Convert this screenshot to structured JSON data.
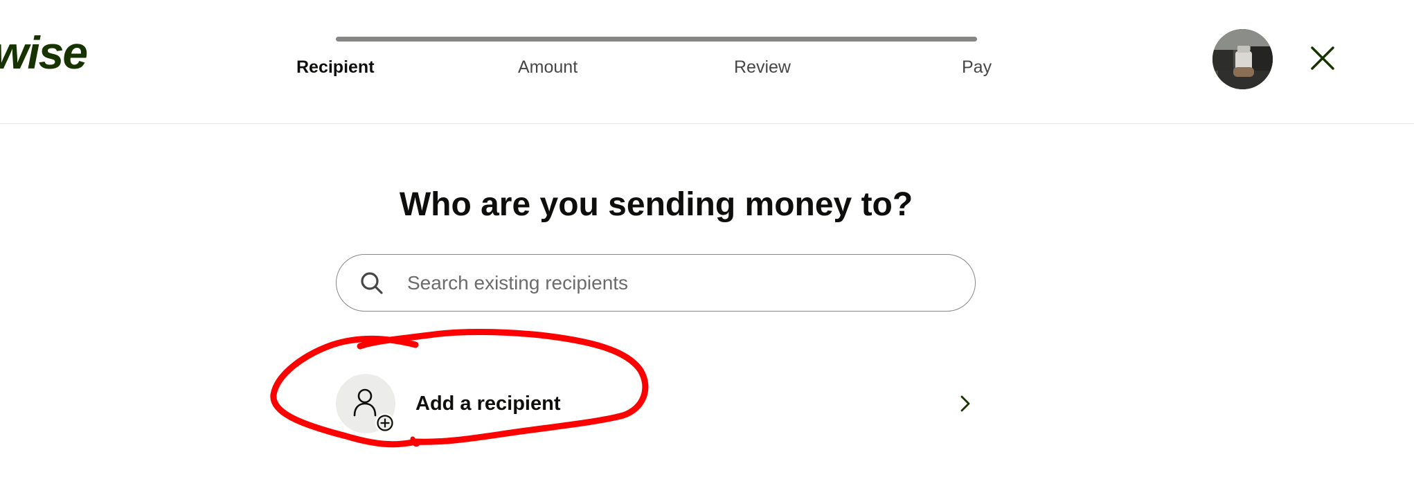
{
  "brand": {
    "logo_text": "wise",
    "logo_color": "#163300"
  },
  "progress": {
    "steps": [
      "Recipient",
      "Amount",
      "Review",
      "Pay"
    ],
    "active_step": "Recipient",
    "track_color": "#868685"
  },
  "header": {
    "avatar_icon": "user-photo",
    "close_icon": "close-icon"
  },
  "main": {
    "title": "Who are you sending money to?",
    "search": {
      "placeholder": "Search existing recipients",
      "value": "",
      "icon": "search-icon"
    },
    "add_recipient": {
      "label": "Add a recipient",
      "icon": "person-add-icon",
      "chevron": "chevron-right-icon"
    }
  },
  "annotation": {
    "color": "#ff0000",
    "shape": "hand-drawn circle around Add a recipient"
  }
}
